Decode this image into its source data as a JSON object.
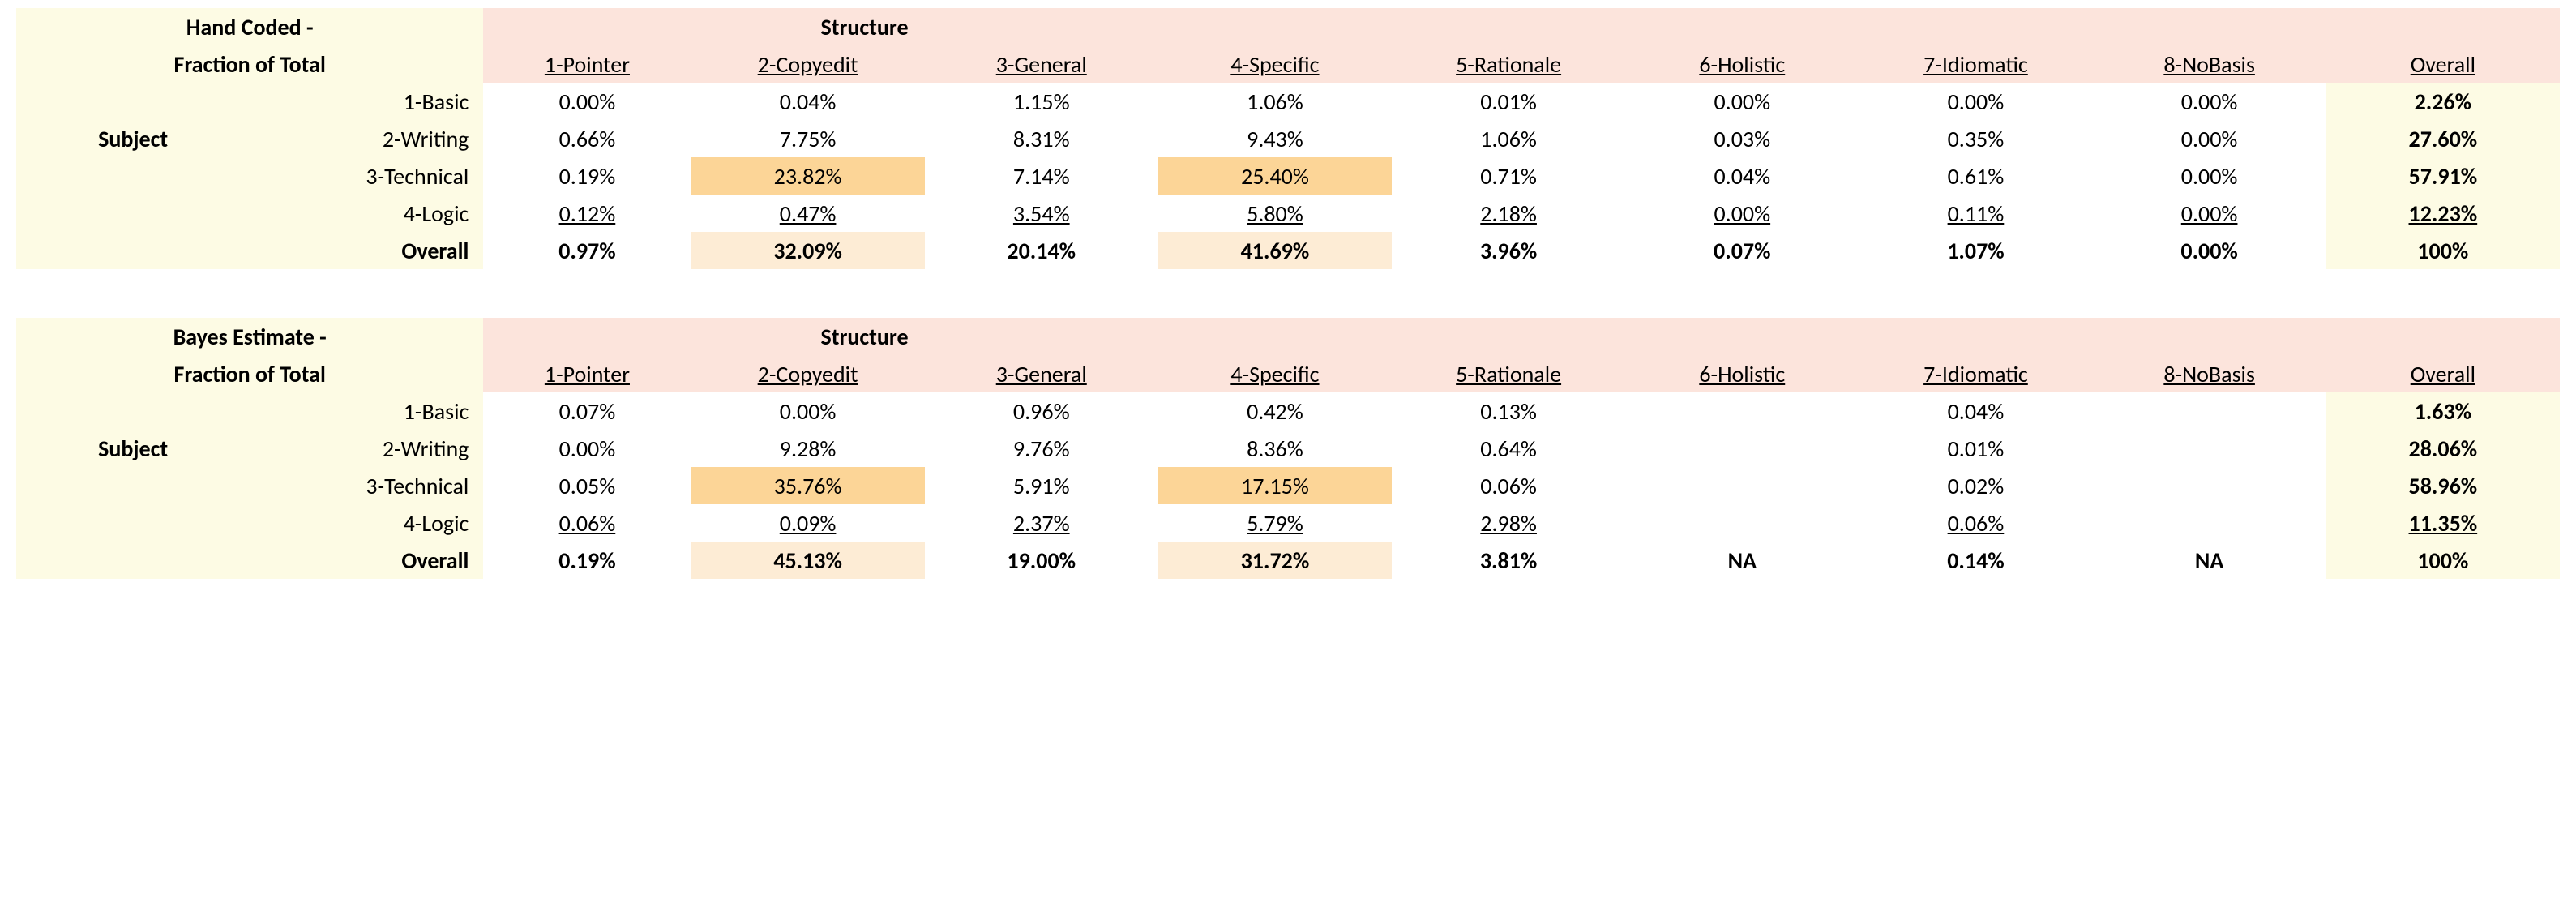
{
  "tables": [
    {
      "title_line1": "Hand Coded -",
      "title_line2": "Fraction of Total",
      "subject_label": "Subject",
      "structure_label": "Structure",
      "columns": [
        "1-Pointer",
        "2-Copyedit",
        "3-General",
        "4-Specific",
        "5-Rationale",
        "6-Holistic",
        "7-Idiomatic",
        "8-NoBasis",
        "Overall"
      ],
      "rows": [
        {
          "label": "1-Basic",
          "cells": [
            "0.00%",
            "0.04%",
            "1.15%",
            "1.06%",
            "0.01%",
            "0.00%",
            "0.00%",
            "0.00%",
            "2.26%"
          ]
        },
        {
          "label": "2-Writing",
          "cells": [
            "0.66%",
            "7.75%",
            "8.31%",
            "9.43%",
            "1.06%",
            "0.03%",
            "0.35%",
            "0.00%",
            "27.60%"
          ]
        },
        {
          "label": "3-Technical",
          "cells": [
            "0.19%",
            "23.82%",
            "7.14%",
            "25.40%",
            "0.71%",
            "0.04%",
            "0.61%",
            "0.00%",
            "57.91%"
          ]
        },
        {
          "label": "4-Logic",
          "cells": [
            "0.12%",
            "0.47%",
            "3.54%",
            "5.80%",
            "2.18%",
            "0.00%",
            "0.11%",
            "0.00%",
            "12.23%"
          ]
        },
        {
          "label": "Overall",
          "cells": [
            "0.97%",
            "32.09%",
            "20.14%",
            "41.69%",
            "3.96%",
            "0.07%",
            "1.07%",
            "0.00%",
            "100%"
          ]
        }
      ],
      "highlights": {
        "strong": [
          [
            2,
            1
          ],
          [
            2,
            3
          ]
        ],
        "weak": [
          [
            4,
            1
          ],
          [
            4,
            3
          ]
        ]
      }
    },
    {
      "title_line1": "Bayes Estimate -",
      "title_line2": "Fraction of Total",
      "subject_label": "Subject",
      "structure_label": "Structure",
      "columns": [
        "1-Pointer",
        "2-Copyedit",
        "3-General",
        "4-Specific",
        "5-Rationale",
        "6-Holistic",
        "7-Idiomatic",
        "8-NoBasis",
        "Overall"
      ],
      "rows": [
        {
          "label": "1-Basic",
          "cells": [
            "0.07%",
            "0.00%",
            "0.96%",
            "0.42%",
            "0.13%",
            "",
            "0.04%",
            "",
            "1.63%"
          ]
        },
        {
          "label": "2-Writing",
          "cells": [
            "0.00%",
            "9.28%",
            "9.76%",
            "8.36%",
            "0.64%",
            "",
            "0.01%",
            "",
            "28.06%"
          ]
        },
        {
          "label": "3-Technical",
          "cells": [
            "0.05%",
            "35.76%",
            "5.91%",
            "17.15%",
            "0.06%",
            "",
            "0.02%",
            "",
            "58.96%"
          ]
        },
        {
          "label": "4-Logic",
          "cells": [
            "0.06%",
            "0.09%",
            "2.37%",
            "5.79%",
            "2.98%",
            "",
            "0.06%",
            "",
            "11.35%"
          ]
        },
        {
          "label": "Overall",
          "cells": [
            "0.19%",
            "45.13%",
            "19.00%",
            "31.72%",
            "3.81%",
            "NA",
            "0.14%",
            "NA",
            "100%"
          ]
        }
      ],
      "highlights": {
        "strong": [
          [
            2,
            1
          ],
          [
            2,
            3
          ]
        ],
        "weak": [
          [
            4,
            1
          ],
          [
            4,
            3
          ]
        ]
      }
    }
  ],
  "chart_data": [
    {
      "type": "table",
      "title": "Hand Coded - Fraction of Total",
      "row_dimension": "Subject",
      "col_dimension": "Structure",
      "row_labels": [
        "1-Basic",
        "2-Writing",
        "3-Technical",
        "4-Logic",
        "Overall"
      ],
      "col_labels": [
        "1-Pointer",
        "2-Copyedit",
        "3-General",
        "4-Specific",
        "5-Rationale",
        "6-Holistic",
        "7-Idiomatic",
        "8-NoBasis",
        "Overall"
      ],
      "values_percent": [
        [
          0.0,
          0.04,
          1.15,
          1.06,
          0.01,
          0.0,
          0.0,
          0.0,
          2.26
        ],
        [
          0.66,
          7.75,
          8.31,
          9.43,
          1.06,
          0.03,
          0.35,
          0.0,
          27.6
        ],
        [
          0.19,
          23.82,
          7.14,
          25.4,
          0.71,
          0.04,
          0.61,
          0.0,
          57.91
        ],
        [
          0.12,
          0.47,
          3.54,
          5.8,
          2.18,
          0.0,
          0.11,
          0.0,
          12.23
        ],
        [
          0.97,
          32.09,
          20.14,
          41.69,
          3.96,
          0.07,
          1.07,
          0.0,
          100
        ]
      ]
    },
    {
      "type": "table",
      "title": "Bayes Estimate - Fraction of Total",
      "row_dimension": "Subject",
      "col_dimension": "Structure",
      "row_labels": [
        "1-Basic",
        "2-Writing",
        "3-Technical",
        "4-Logic",
        "Overall"
      ],
      "col_labels": [
        "1-Pointer",
        "2-Copyedit",
        "3-General",
        "4-Specific",
        "5-Rationale",
        "6-Holistic",
        "7-Idiomatic",
        "8-NoBasis",
        "Overall"
      ],
      "values_percent": [
        [
          0.07,
          0.0,
          0.96,
          0.42,
          0.13,
          null,
          0.04,
          null,
          1.63
        ],
        [
          0.0,
          9.28,
          9.76,
          8.36,
          0.64,
          null,
          0.01,
          null,
          28.06
        ],
        [
          0.05,
          35.76,
          5.91,
          17.15,
          0.06,
          null,
          0.02,
          null,
          58.96
        ],
        [
          0.06,
          0.09,
          2.37,
          5.79,
          2.98,
          null,
          0.06,
          null,
          11.35
        ],
        [
          0.19,
          45.13,
          19.0,
          31.72,
          3.81,
          "NA",
          0.14,
          "NA",
          100
        ]
      ]
    }
  ]
}
